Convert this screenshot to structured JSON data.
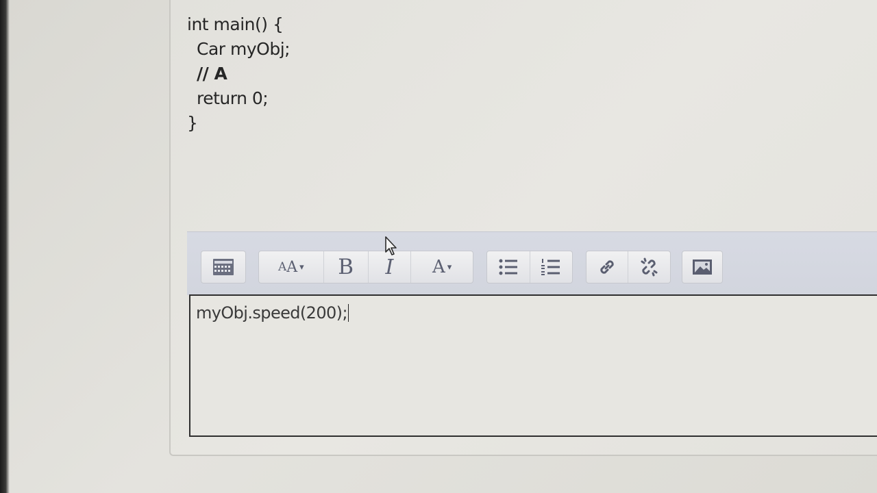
{
  "code": {
    "lines": [
      {
        "text": "int main() {",
        "indent": false,
        "comment": false
      },
      {
        "text": "Car myObj;",
        "indent": true,
        "comment": false
      },
      {
        "text": "// A",
        "indent": true,
        "comment": true
      },
      {
        "text": "return 0;",
        "indent": true,
        "comment": false
      },
      {
        "text": "}",
        "indent": false,
        "comment": false
      }
    ]
  },
  "toolbar": {
    "font_size_icon": "font-size-icon",
    "bold_label": "B",
    "italic_label": "I",
    "font_color_label": "A",
    "caret": "▾",
    "icons": [
      "toolbar-toggle-icon",
      "font-size-icon",
      "bold-icon",
      "italic-icon",
      "font-color-icon",
      "unordered-list-icon",
      "ordered-list-icon",
      "link-icon",
      "unlink-icon",
      "image-icon"
    ]
  },
  "editor": {
    "value": "myObj.speed(200);"
  },
  "colors": {
    "toolbar_bg": "#d4d7e0",
    "icon": "#5a5e70",
    "text": "#262626"
  }
}
